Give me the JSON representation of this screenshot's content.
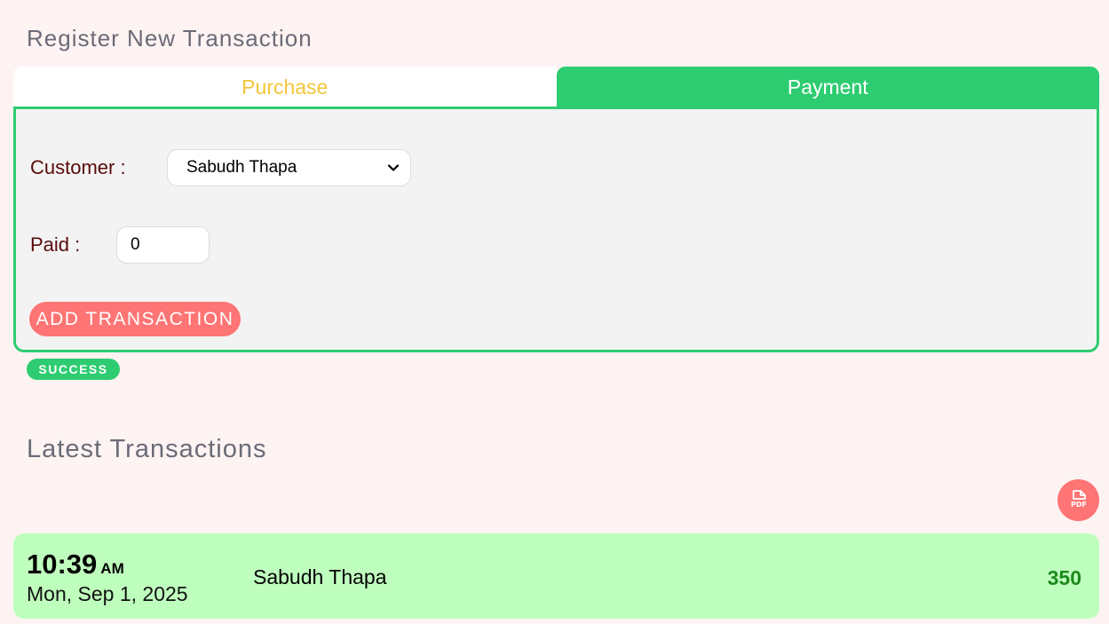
{
  "register": {
    "title": "Register New Transaction",
    "tabs": [
      {
        "label": "Purchase",
        "active": false
      },
      {
        "label": "Payment",
        "active": true
      }
    ],
    "form": {
      "customer_label": "Customer :",
      "customer_value": "Sabudh Thapa",
      "paid_label": "Paid :",
      "paid_value": "0",
      "submit_label": "ADD TRANSACTION"
    },
    "status_badge": "SUCCESS"
  },
  "latest": {
    "title": "Latest Transactions",
    "pdf_icon_text": "PDF",
    "transactions": [
      {
        "time": "10:39",
        "ampm": "AM",
        "date": "Mon, Sep 1, 2025",
        "customer": "Sabudh Thapa",
        "amount": "350"
      }
    ]
  },
  "colors": {
    "background": "#fdf3f2",
    "accent_green": "#2ecc71",
    "accent_red": "#ff7474",
    "purchase_tab_text": "#f3c63b",
    "row_background": "#bfffbe",
    "amount_text": "#1b8a1b"
  },
  "icons": {
    "select_chevron": "chevron-down-icon",
    "pdf_export": "pdf-file-icon"
  }
}
